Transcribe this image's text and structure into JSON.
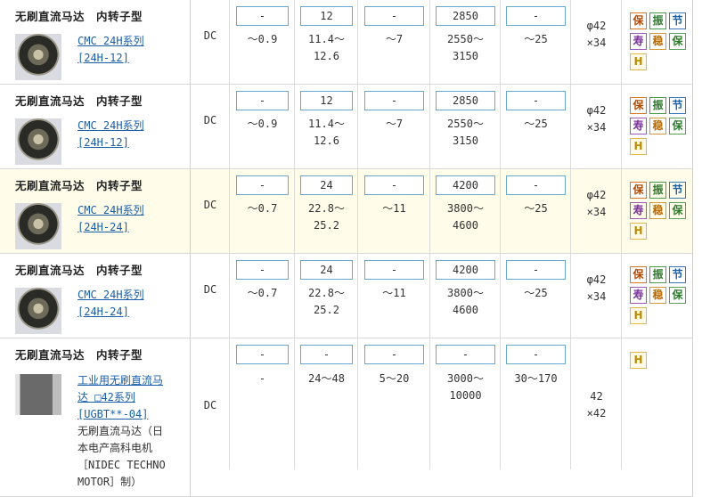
{
  "rows": [
    {
      "title": "无刷直流马达　内转子型",
      "link": [
        "CMC 24H系列",
        "[24H-12]"
      ],
      "note": [],
      "type": "DC",
      "boxes": [
        "-",
        "12",
        "-",
        "2850",
        "-"
      ],
      "values": [
        [
          "～0.9"
        ],
        [
          "11.4～",
          "12.6"
        ],
        [
          "～7"
        ],
        [
          "2550～",
          "3150"
        ],
        [
          "～25"
        ]
      ],
      "size": [
        "φ42",
        "×34"
      ],
      "icons": [
        "保",
        "振",
        "节",
        "寿",
        "稳",
        "保",
        "H"
      ]
    },
    {
      "title": "无刷直流马达　内转子型",
      "link": [
        "CMC 24H系列",
        "[24H-12]"
      ],
      "note": [],
      "type": "DC",
      "boxes": [
        "-",
        "12",
        "-",
        "2850",
        "-"
      ],
      "values": [
        [
          "～0.9"
        ],
        [
          "11.4～",
          "12.6"
        ],
        [
          "～7"
        ],
        [
          "2550～",
          "3150"
        ],
        [
          "～25"
        ]
      ],
      "size": [
        "φ42",
        "×34"
      ],
      "icons": [
        "保",
        "振",
        "节",
        "寿",
        "稳",
        "保",
        "H"
      ]
    },
    {
      "title": "无刷直流马达　内转子型",
      "link": [
        "CMC 24H系列",
        "[24H-24]"
      ],
      "note": [],
      "type": "DC",
      "boxes": [
        "-",
        "24",
        "-",
        "4200",
        "-"
      ],
      "values": [
        [
          "～0.7"
        ],
        [
          "22.8～",
          "25.2"
        ],
        [
          "～11"
        ],
        [
          "3800～",
          "4600"
        ],
        [
          "～25"
        ]
      ],
      "size": [
        "φ42",
        "×34"
      ],
      "icons": [
        "保",
        "振",
        "节",
        "寿",
        "稳",
        "保",
        "H"
      ]
    },
    {
      "title": "无刷直流马达　内转子型",
      "link": [
        "CMC 24H系列",
        "[24H-24]"
      ],
      "note": [],
      "type": "DC",
      "boxes": [
        "-",
        "24",
        "-",
        "4200",
        "-"
      ],
      "values": [
        [
          "～0.7"
        ],
        [
          "22.8～",
          "25.2"
        ],
        [
          "～11"
        ],
        [
          "3800～",
          "4600"
        ],
        [
          "～25"
        ]
      ],
      "size": [
        "φ42",
        "×34"
      ],
      "icons": [
        "保",
        "振",
        "节",
        "寿",
        "稳",
        "保",
        "H"
      ]
    },
    {
      "title": "无刷直流马达　内转子型",
      "link": [
        "工业用无刷直流马",
        "达 □42系列",
        "[UGBT**-04]"
      ],
      "note": [
        "无刷直流马达（日",
        "本电产高科电机",
        "［NIDEC TECHNO",
        "MOTOR］制）"
      ],
      "type": "DC",
      "boxes": [
        "-",
        "-",
        "-",
        "-",
        "-"
      ],
      "values": [
        [
          "-"
        ],
        [
          "24～48"
        ],
        [
          "5～20"
        ],
        [
          "3000～",
          "10000"
        ],
        [
          "30～170"
        ]
      ],
      "size": [
        "42",
        "×42"
      ],
      "icons": [
        "H"
      ]
    }
  ]
}
